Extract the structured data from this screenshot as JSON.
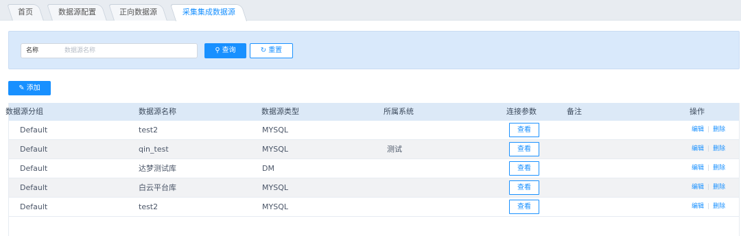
{
  "tabs": [
    {
      "label": "首页"
    },
    {
      "label": "数据源配置"
    },
    {
      "label": "正向数据源"
    },
    {
      "label": "采集集成数据源"
    }
  ],
  "search": {
    "label": "名称",
    "placeholder": "数据源名称",
    "value": "",
    "query_label": "查询",
    "reset_label": "重置"
  },
  "toolbar": {
    "add_label": "添加"
  },
  "table": {
    "columns": [
      "数据源分组",
      "数据源名称",
      "数据源类型",
      "所属系统",
      "连接参数",
      "备注",
      "操作"
    ],
    "rows": [
      {
        "group": "Default",
        "name": "test2",
        "type": "MYSQL",
        "system": "",
        "params_label": "查看",
        "remark": "",
        "edit_label": "编辑",
        "delete_label": "删除"
      },
      {
        "group": "Default",
        "name": "qin_test",
        "type": "MYSQL",
        "system": "测试",
        "params_label": "查看",
        "remark": "",
        "edit_label": "编辑",
        "delete_label": "删除"
      },
      {
        "group": "Default",
        "name": "达梦测试库",
        "type": "DM",
        "system": "",
        "params_label": "查看",
        "remark": "",
        "edit_label": "编辑",
        "delete_label": "删除"
      },
      {
        "group": "Default",
        "name": "白云平台库",
        "type": "MYSQL",
        "system": "",
        "params_label": "查看",
        "remark": "",
        "edit_label": "编辑",
        "delete_label": "删除"
      },
      {
        "group": "Default",
        "name": "test2",
        "type": "MYSQL",
        "system": "",
        "params_label": "查看",
        "remark": "",
        "edit_label": "编辑",
        "delete_label": "删除"
      }
    ]
  },
  "colors": {
    "accent": "#1890ff",
    "panel": "#d9e9fb",
    "header": "#dce9f7"
  }
}
